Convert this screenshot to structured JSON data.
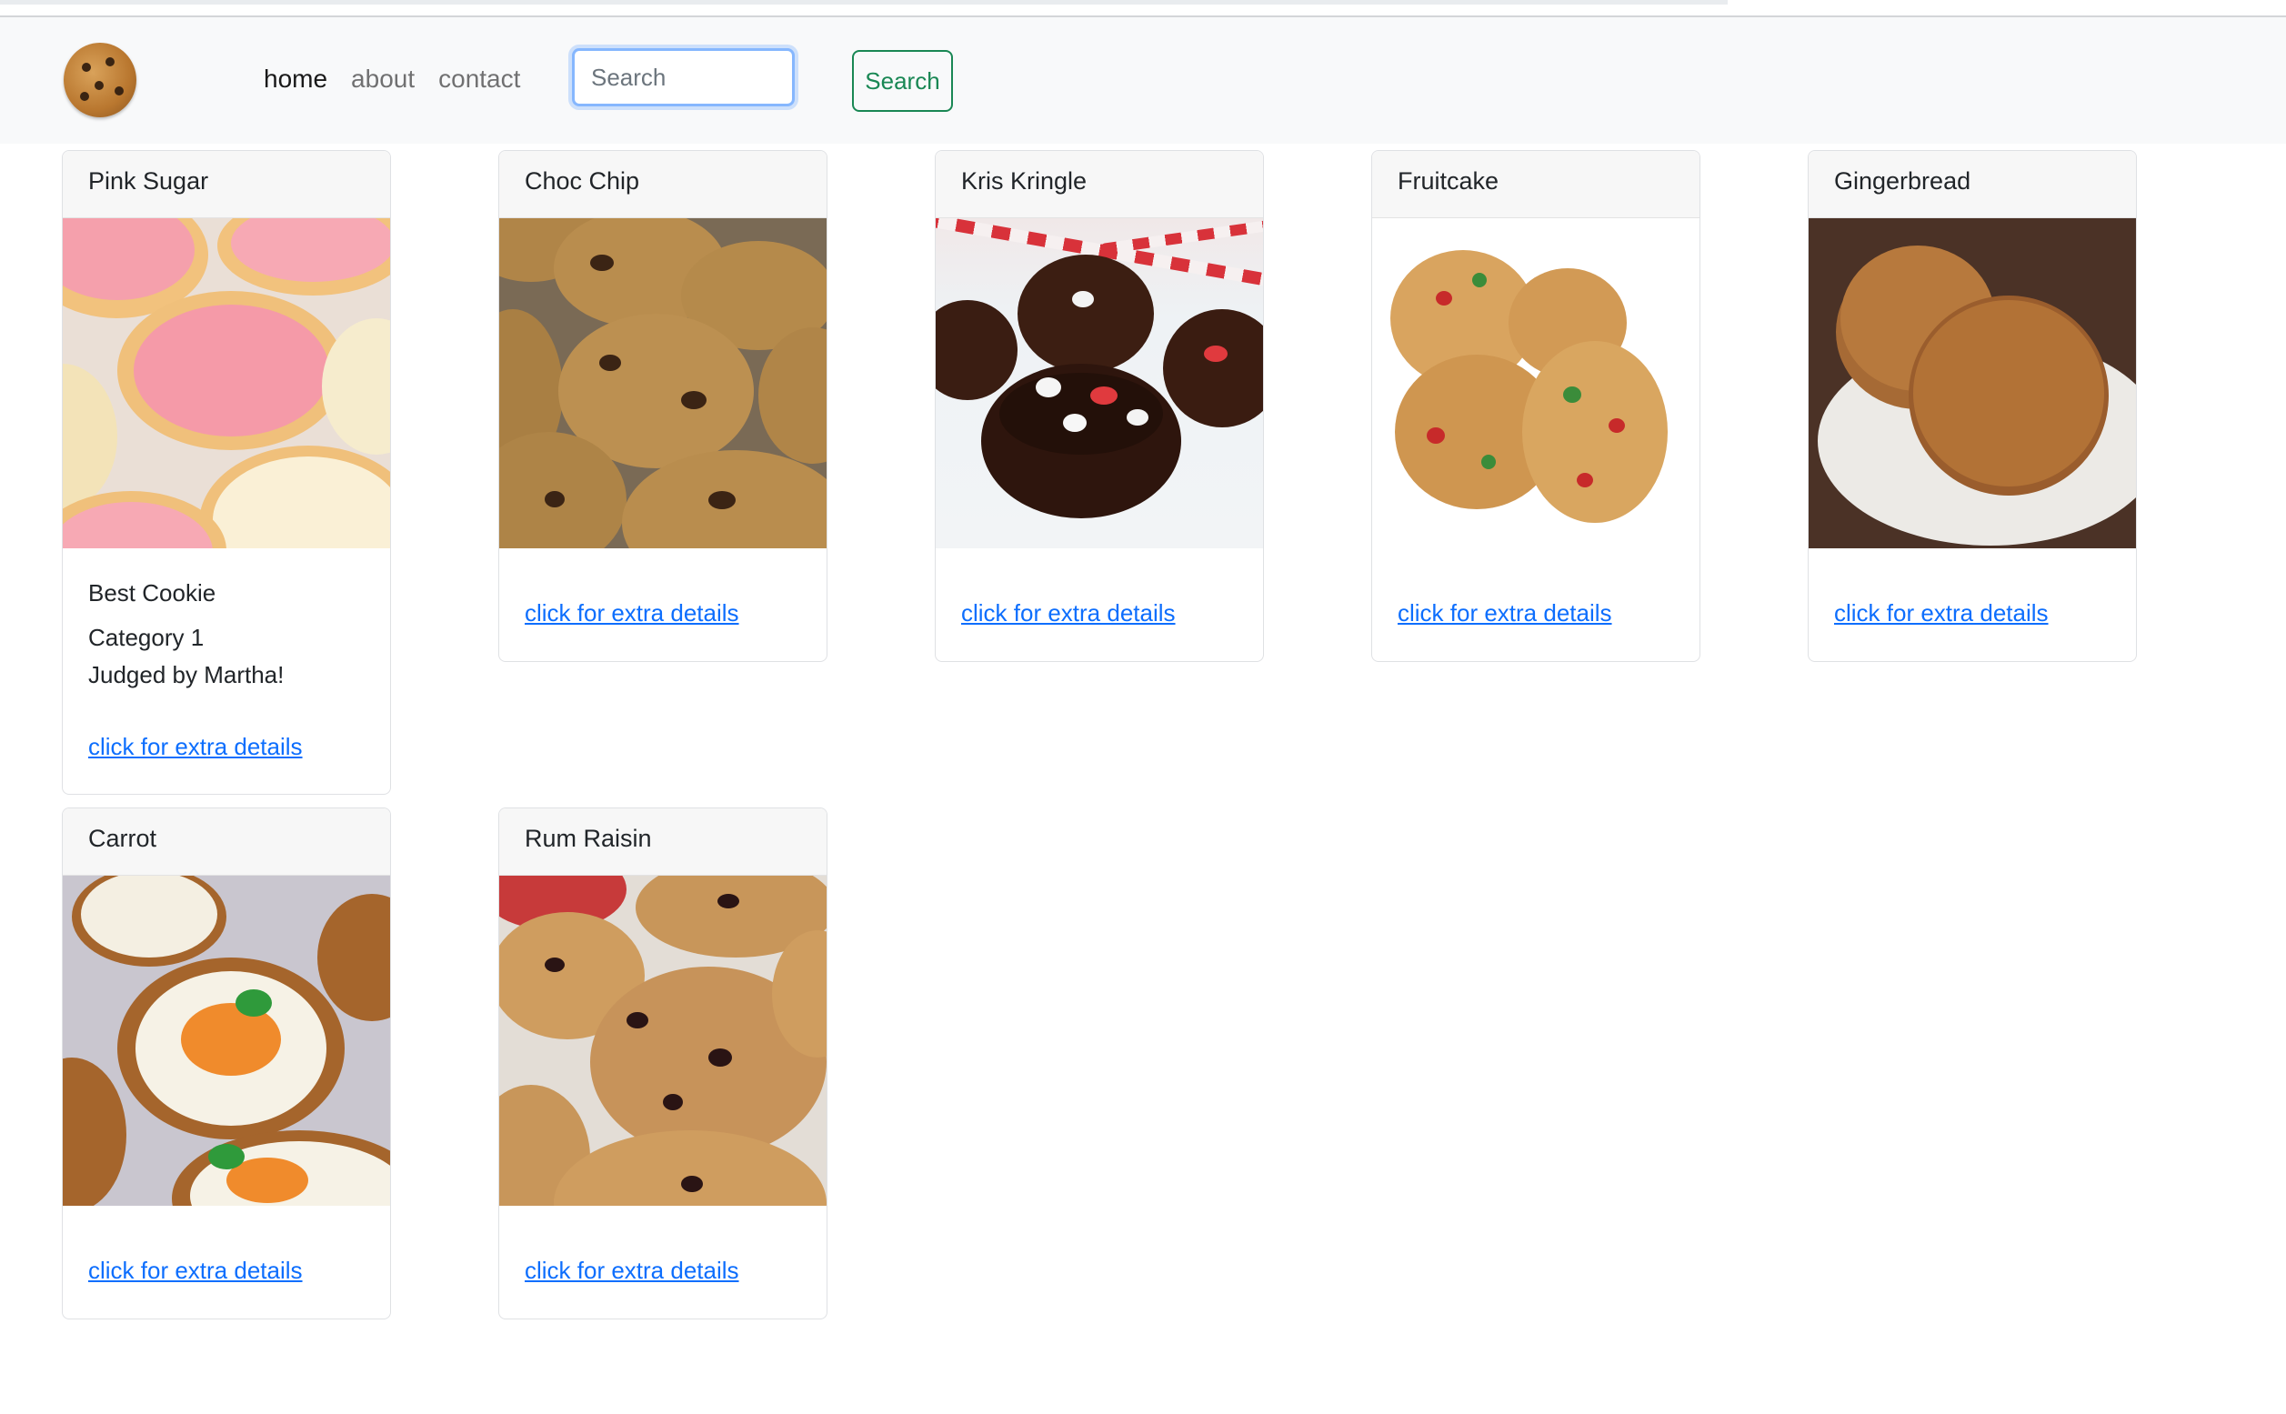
{
  "navbar": {
    "logo_icon": "cookie-logo-icon",
    "links": [
      "home",
      "about",
      "contact"
    ],
    "active_link": "home",
    "search_placeholder": "Search",
    "search_button": "Search"
  },
  "cards": [
    {
      "title": "Pink Sugar",
      "image": "pink-sugar-cookies-photo",
      "details": {
        "line1": "Best Cookie",
        "line2": "Category 1",
        "line3": "Judged by Martha!"
      },
      "link": "click for extra details"
    },
    {
      "title": "Choc Chip",
      "image": "choc-chip-cookies-photo",
      "link": "click for extra details"
    },
    {
      "title": "Kris Kringle",
      "image": "kris-kringle-cookies-photo",
      "link": "click for extra details"
    },
    {
      "title": "Fruitcake",
      "image": "fruitcake-cookies-photo",
      "link": "click for extra details"
    },
    {
      "title": "Gingerbread",
      "image": "gingerbread-cookies-photo",
      "link": "click for extra details"
    },
    {
      "title": "Carrot",
      "image": "carrot-cookies-photo",
      "link": "click for extra details"
    },
    {
      "title": "Rum Raisin",
      "image": "rum-raisin-cookies-photo",
      "link": "click for extra details"
    }
  ],
  "colors": {
    "link": "#0d6efd",
    "success": "#198754",
    "navbar_bg": "#f8f9fa"
  }
}
